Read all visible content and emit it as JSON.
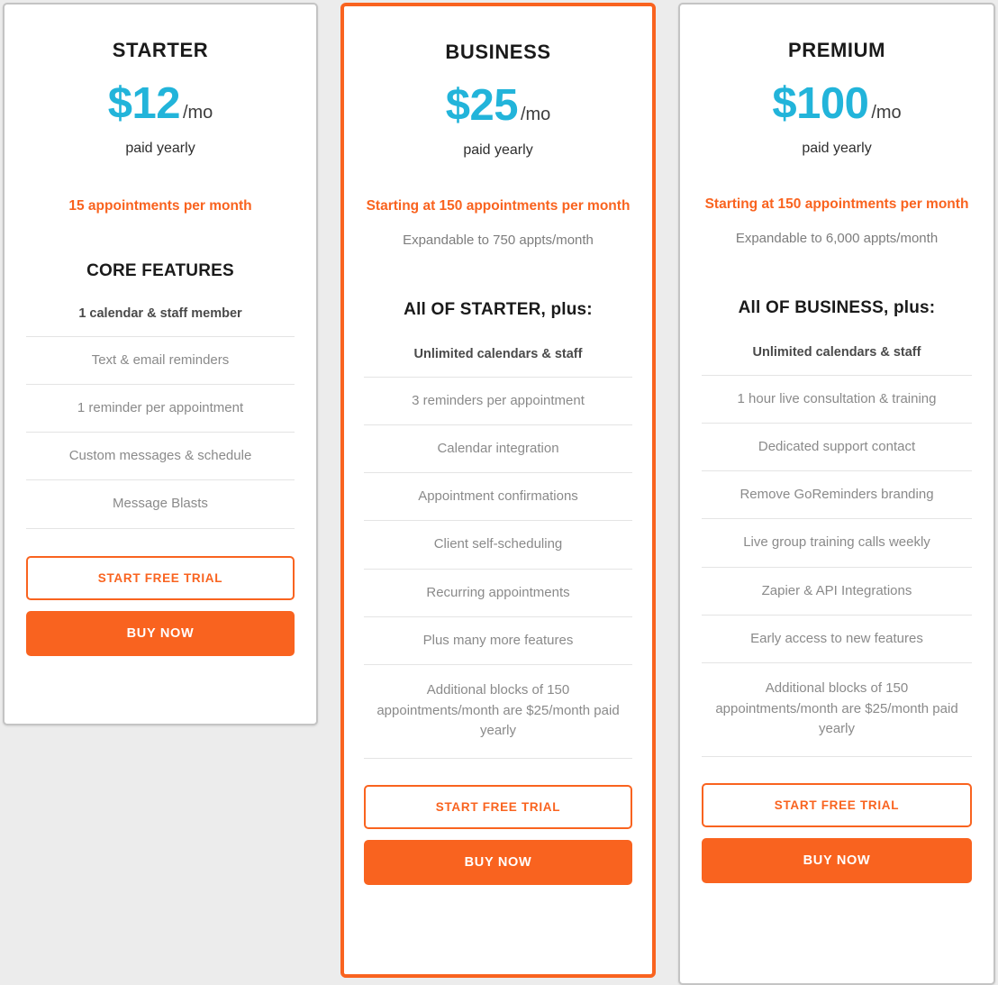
{
  "theme": {
    "accent_orange": "#f9631f",
    "price_cyan": "#22b4da",
    "page_background": "#ececec",
    "card_border": "#c4c4c4",
    "divider": "#e4e4e4",
    "feature_text": "#8a8a8a"
  },
  "plans": [
    {
      "id": "starter",
      "name": "STARTER",
      "price": "$12",
      "period": "/mo",
      "billing_note": "paid yearly",
      "appointments_headline": "15 appointments per month",
      "expandable_note": "",
      "features_heading": "CORE FEATURES",
      "features": [
        "1 calendar & staff member",
        "Text & email reminders",
        "1 reminder per appointment",
        "Custom messages & schedule",
        "Message Blasts"
      ],
      "trial_button": "START FREE TRIAL",
      "buy_button": "BUY NOW",
      "highlighted": false
    },
    {
      "id": "business",
      "name": "BUSINESS",
      "price": "$25",
      "period": "/mo",
      "billing_note": "paid yearly",
      "appointments_headline": "Starting at 150 appointments per month",
      "expandable_note": "Expandable to 750 appts/month",
      "features_heading": "All OF STARTER, plus:",
      "features": [
        "Unlimited calendars & staff",
        "3 reminders per appointment",
        "Calendar integration",
        "Appointment confirmations",
        "Client self-scheduling",
        "Recurring appointments",
        "Plus many more features",
        "Additional blocks of 150 appointments/month are $25/month paid yearly"
      ],
      "trial_button": "START FREE TRIAL",
      "buy_button": "BUY NOW",
      "highlighted": true
    },
    {
      "id": "premium",
      "name": "PREMIUM",
      "price": "$100",
      "period": "/mo",
      "billing_note": "paid yearly",
      "appointments_headline": "Starting at 150 appointments per month",
      "expandable_note": "Expandable to 6,000 appts/month",
      "features_heading": "All OF BUSINESS, plus:",
      "features": [
        "Unlimited calendars & staff",
        "1 hour live consultation & training",
        "Dedicated support contact",
        "Remove GoReminders branding",
        "Live group training calls weekly",
        "Zapier & API Integrations",
        "Early access to new features",
        "Additional blocks of 150 appointments/month are $25/month paid yearly"
      ],
      "trial_button": "START FREE TRIAL",
      "buy_button": "BUY NOW",
      "highlighted": false
    }
  ]
}
